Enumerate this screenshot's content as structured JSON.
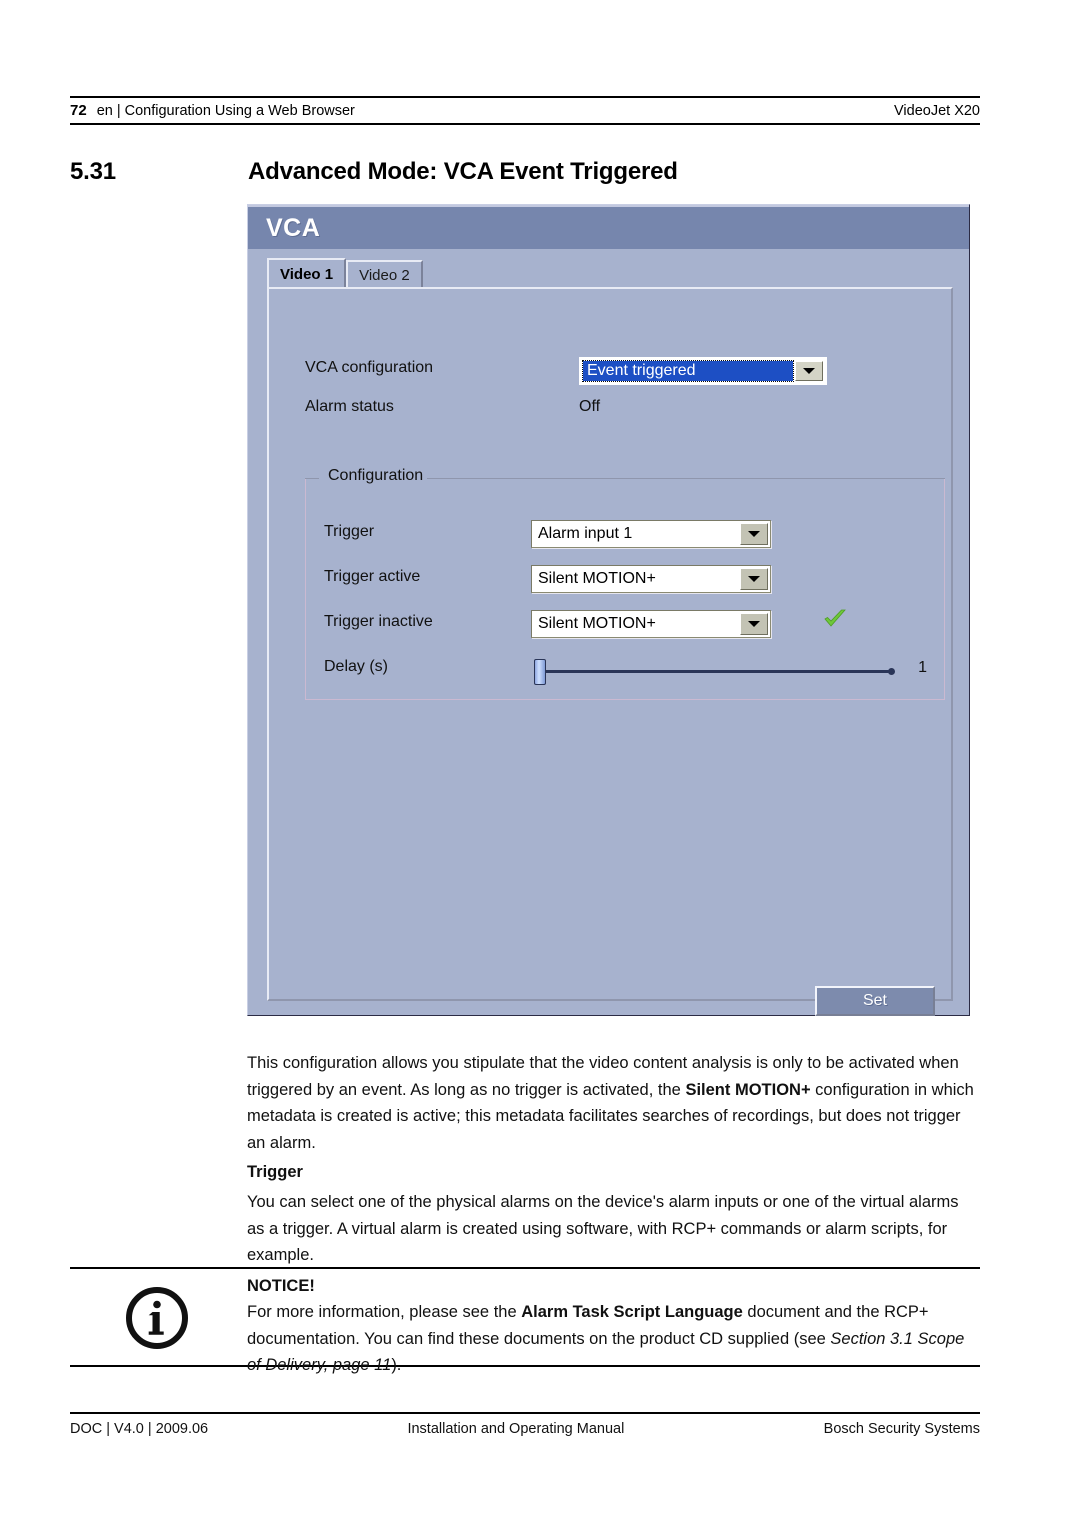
{
  "page_header": {
    "page_number": "72",
    "breadcrumb": "en | Configuration Using a Web Browser",
    "product": "VideoJet X20"
  },
  "section": {
    "number": "5.31",
    "title": "Advanced Mode: VCA Event Triggered"
  },
  "vca_dialog": {
    "title": "VCA",
    "tabs": [
      {
        "label": "Video 1",
        "active": true
      },
      {
        "label": "Video 2",
        "active": false
      }
    ],
    "vca_configuration": {
      "label": "VCA configuration",
      "value": "Event triggered"
    },
    "alarm_status": {
      "label": "Alarm status",
      "value": "Off"
    },
    "configuration_group": {
      "legend": "Configuration",
      "trigger": {
        "label": "Trigger",
        "value": "Alarm input 1"
      },
      "trigger_active": {
        "label": "Trigger active",
        "value": "Silent MOTION+"
      },
      "trigger_inactive": {
        "label": "Trigger inactive",
        "value": "Silent MOTION+"
      },
      "delay": {
        "label": "Delay (s)",
        "value": "1"
      }
    },
    "set_button": "Set",
    "colors": {
      "titlebar": "#7686ad",
      "body": "#a7b2ce",
      "selection": "#1d4fc4",
      "checkmark": "#62c23c"
    }
  },
  "body": {
    "intro_1": "This configuration allows you stipulate that the video content analysis is only to be activated when triggered by an event. As long as no trigger is activated, the ",
    "intro_bold": "Silent MOTION+",
    "intro_2": " configuration in which metadata is created is active; this metadata facilitates searches of recordings, but does not trigger an alarm.",
    "trigger_heading": "Trigger",
    "trigger_paragraph": "You can select one of the physical alarms on the device's alarm inputs or one of the virtual alarms as a trigger. A virtual alarm is created using software, with RCP+ commands or alarm scripts, for example."
  },
  "notice": {
    "title": "NOTICE!",
    "text_1": "For more information, please see the ",
    "text_bold": "Alarm Task Script Language",
    "text_2": " document and the RCP+ documentation. You can find these documents on the product CD supplied (see ",
    "text_italic": "Section 3.1 Scope of Delivery, page 11",
    "text_3": ")."
  },
  "page_footer": {
    "left": "DOC | V4.0 | 2009.06",
    "center": "Installation and Operating Manual",
    "right": "Bosch Security Systems"
  }
}
